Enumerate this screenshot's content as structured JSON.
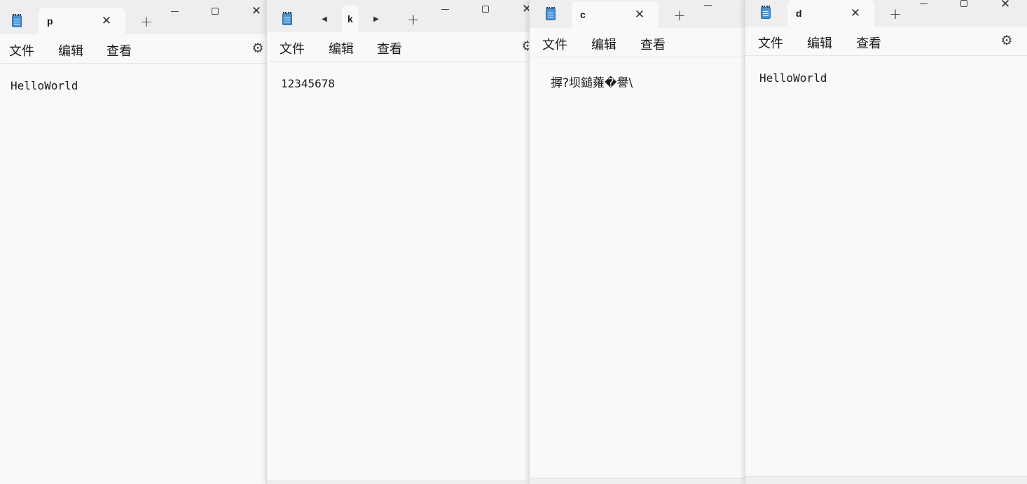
{
  "windows": [
    {
      "tab_title": "p",
      "menu": [
        "文件",
        "编辑",
        "查看"
      ],
      "content": "HelloWorld"
    },
    {
      "tab_title": "k",
      "menu": [
        "文件",
        "编辑",
        "查看"
      ],
      "content": "12345678"
    },
    {
      "tab_title": "c",
      "menu": [
        "文件",
        "编辑",
        "查看"
      ],
      "content": "搱?坝鎚蕹�譽\\"
    },
    {
      "tab_title": "d",
      "menu": [
        "文件",
        "编辑",
        "查看"
      ],
      "content": "HelloWorld"
    }
  ],
  "icons": {
    "app": "notepad-icon",
    "close_tab": "close-icon",
    "new_tab": "plus-icon",
    "scroll_left": "caret-left-icon",
    "scroll_right": "caret-right-icon",
    "settings": "gear-icon"
  },
  "colors": {
    "titlebar": "#eeeeee",
    "editor_bg": "#f9f9f9",
    "icon_blue": "#4a93d2"
  }
}
